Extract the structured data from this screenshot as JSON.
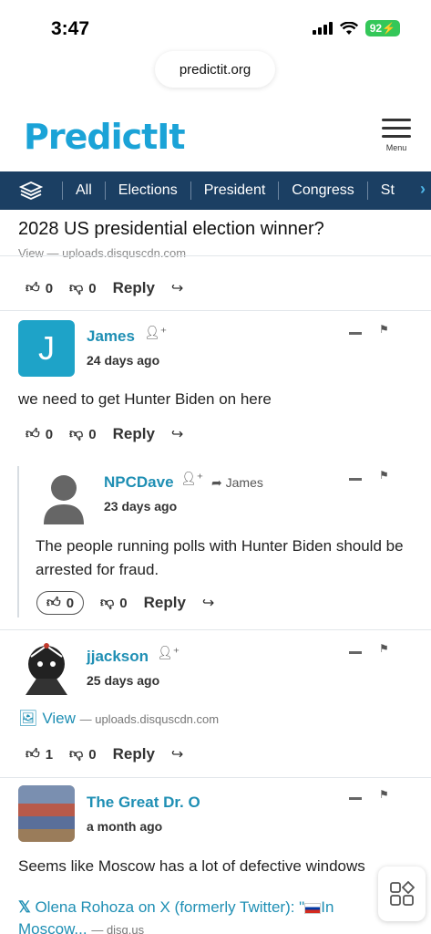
{
  "status": {
    "time": "3:47",
    "battery": "92"
  },
  "browser": {
    "url": "predictit.org"
  },
  "header": {
    "logo": "PredictIt",
    "menu_label": "Menu"
  },
  "nav": {
    "items": [
      "All",
      "Elections",
      "President",
      "Congress",
      "St"
    ]
  },
  "market": {
    "title": "2028 US presidential election winner?",
    "partial_link": "View — uploads.disquscdn.com"
  },
  "comments": [
    {
      "likes": "0",
      "dislikes": "0",
      "reply": "Reply"
    },
    {
      "author": "James",
      "initial": "J",
      "time": "24 days ago",
      "text": "we need to get Hunter Biden on here",
      "likes": "0",
      "dislikes": "0",
      "reply": "Reply"
    },
    {
      "author": "NPCDave",
      "reply_to": "James",
      "time": "23 days ago",
      "text": "The people running polls with Hunter Biden should be arrested for fraud.",
      "likes": "0",
      "dislikes": "0",
      "reply": "Reply"
    },
    {
      "author": "jjackson",
      "time": "25 days ago",
      "link_label": "View",
      "link_host": "— uploads.disquscdn.com",
      "likes": "1",
      "dislikes": "0",
      "reply": "Reply"
    },
    {
      "author": "The Great Dr. O",
      "time": "a month ago",
      "text": "Seems like Moscow has a lot of defective windows",
      "link_label": "Olena Rohoza on X (formerly Twitter): \"",
      "link_label2": "In",
      "link_label3": "Moscow...",
      "link_host": "— disq.us"
    }
  ],
  "colors": {
    "brand": "#1ba3d7",
    "nav_bg": "#1b3f63",
    "username": "#1f8fb4",
    "avatar_j": "#1ea3c8"
  }
}
